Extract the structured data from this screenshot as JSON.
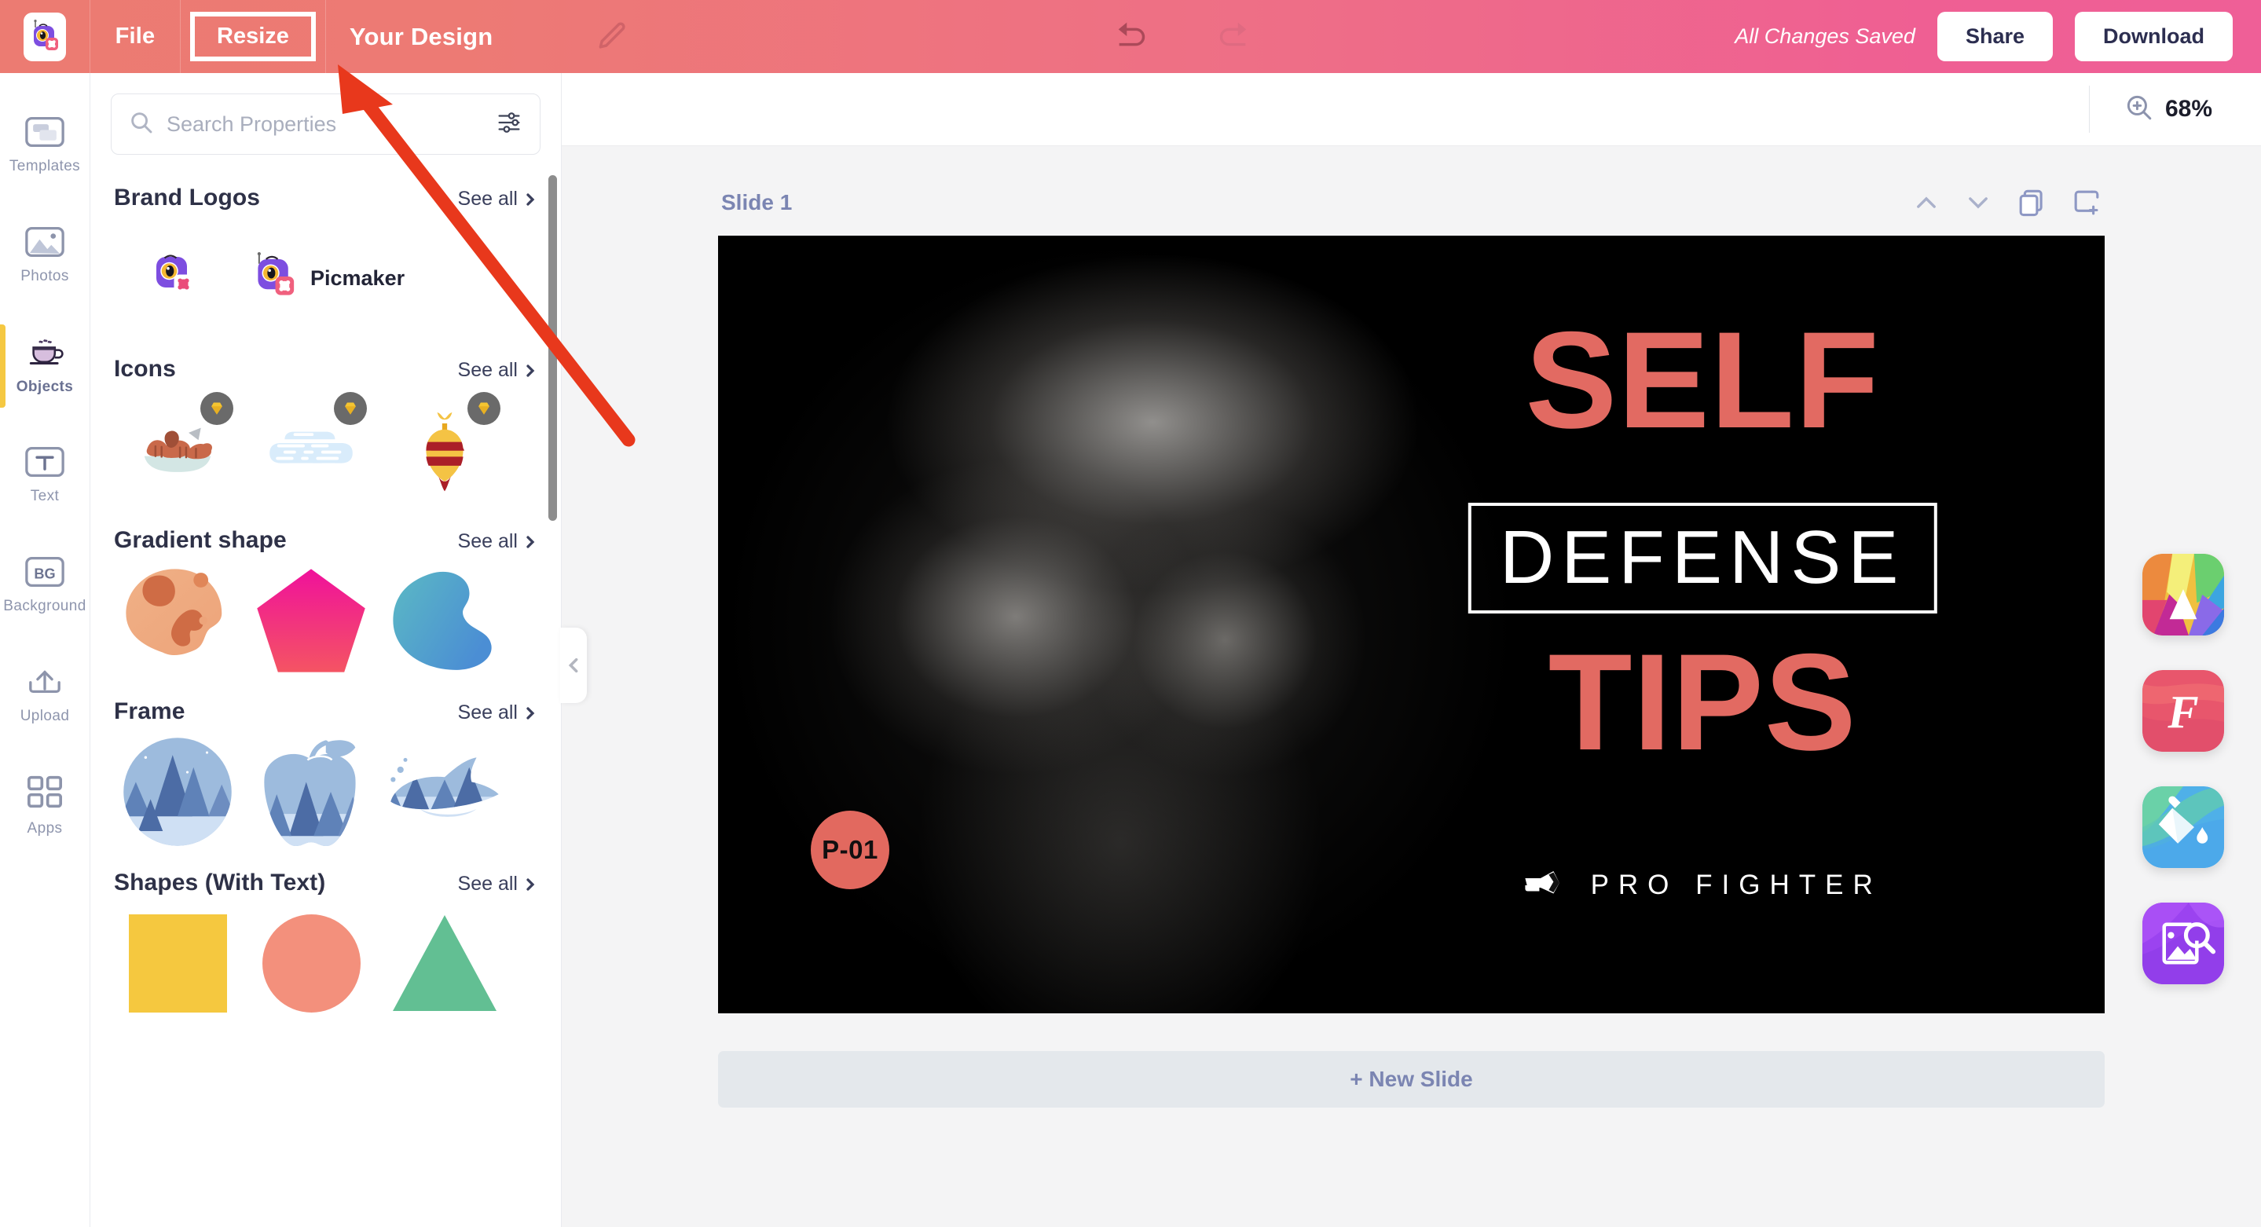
{
  "header": {
    "logo_name": "picmaker-logo",
    "file_label": "File",
    "resize_label": "Resize",
    "design_title": "Your Design",
    "pencil_icon": "pencil-icon",
    "undo_icon": "undo-icon",
    "redo_icon": "redo-icon",
    "save_status": "All Changes Saved",
    "share_label": "Share",
    "download_label": "Download"
  },
  "rail": {
    "items": [
      {
        "label": "Templates",
        "icon": "templates-icon",
        "active": false
      },
      {
        "label": "Photos",
        "icon": "photos-icon",
        "active": false
      },
      {
        "label": "Objects",
        "icon": "objects-coffee-icon",
        "active": true
      },
      {
        "label": "Text",
        "icon": "text-icon",
        "active": false
      },
      {
        "label": "Background",
        "icon": "background-icon",
        "active": false
      },
      {
        "label": "Upload",
        "icon": "upload-icon",
        "active": false
      },
      {
        "label": "Apps",
        "icon": "apps-grid-icon",
        "active": false
      }
    ]
  },
  "panel": {
    "search": {
      "placeholder": "Search Properties",
      "value": "",
      "icon": "search-icon",
      "filter_icon": "filter-sliders-icon"
    },
    "see_all_label": "See all",
    "sections": [
      {
        "title": "Brand Logos",
        "brand_name": "Picmaker"
      },
      {
        "title": "Icons"
      },
      {
        "title": "Gradient shape"
      },
      {
        "title": "Frame"
      },
      {
        "title": "Shapes (With Text)"
      }
    ],
    "collapse_icon": "chevron-left-icon"
  },
  "stage": {
    "zoom_icon": "zoom-in-icon",
    "zoom_value": "68%",
    "slide_name": "Slide 1",
    "tools": [
      {
        "name": "move-slide-up",
        "icon": "chevron-up-icon"
      },
      {
        "name": "move-slide-down",
        "icon": "chevron-down-icon"
      },
      {
        "name": "duplicate-slide",
        "icon": "duplicate-icon"
      },
      {
        "name": "add-slide",
        "icon": "add-frame-icon"
      }
    ],
    "new_slide_label": "+ New Slide"
  },
  "design": {
    "line1": "SELF",
    "line2": "DEFENSE",
    "line3": "TIPS",
    "brand_line": "PRO FIGHTER",
    "brand_icon": "fist-icon",
    "badge": "P-01",
    "accent_color": "#e26a62",
    "bg_color": "#000000"
  },
  "floaters": [
    {
      "name": "magic-palette-app",
      "icon": "rainbow-mountain-icon"
    },
    {
      "name": "fonts-app",
      "icon": "font-f-icon"
    },
    {
      "name": "color-fill-app",
      "icon": "paint-bucket-icon"
    },
    {
      "name": "image-search-app",
      "icon": "image-search-icon"
    }
  ],
  "annotation": {
    "arrow_color": "#e8381c",
    "points_to": "resize-button"
  }
}
